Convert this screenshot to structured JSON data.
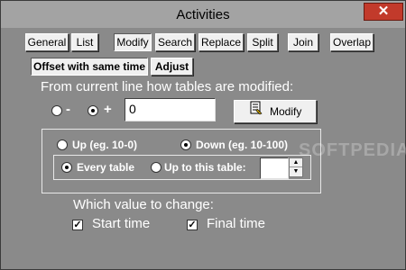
{
  "window": {
    "title": "Activities",
    "close_glyph": "✕"
  },
  "tabs": [
    {
      "label": "General"
    },
    {
      "label": "List"
    },
    {
      "label": "Modify"
    },
    {
      "label": "Search"
    },
    {
      "label": "Replace"
    },
    {
      "label": "Split"
    },
    {
      "label": "Join"
    },
    {
      "label": "Overlap"
    }
  ],
  "subtabs": [
    {
      "label": "Offset with same time"
    },
    {
      "label": "Adjust"
    }
  ],
  "offset": {
    "heading": "From current line how tables are modified:",
    "minus_label": "-",
    "plus_label": "+",
    "value": "0",
    "modify_button": "Modify"
  },
  "direction": {
    "up_label": "Up (eg. 10-0)",
    "down_label": "Down (eg. 10-100)",
    "every_table_label": "Every table",
    "up_to_table_label": "Up to this table:",
    "up_to_value": ""
  },
  "which_value": {
    "heading": "Which value to change:",
    "start_time": "Start time",
    "final_time": "Final time"
  },
  "watermark": "SOFTPEDIA",
  "colors": {
    "background": "#8a8a8a",
    "close": "#c23a2b",
    "text": "#ffffff"
  }
}
